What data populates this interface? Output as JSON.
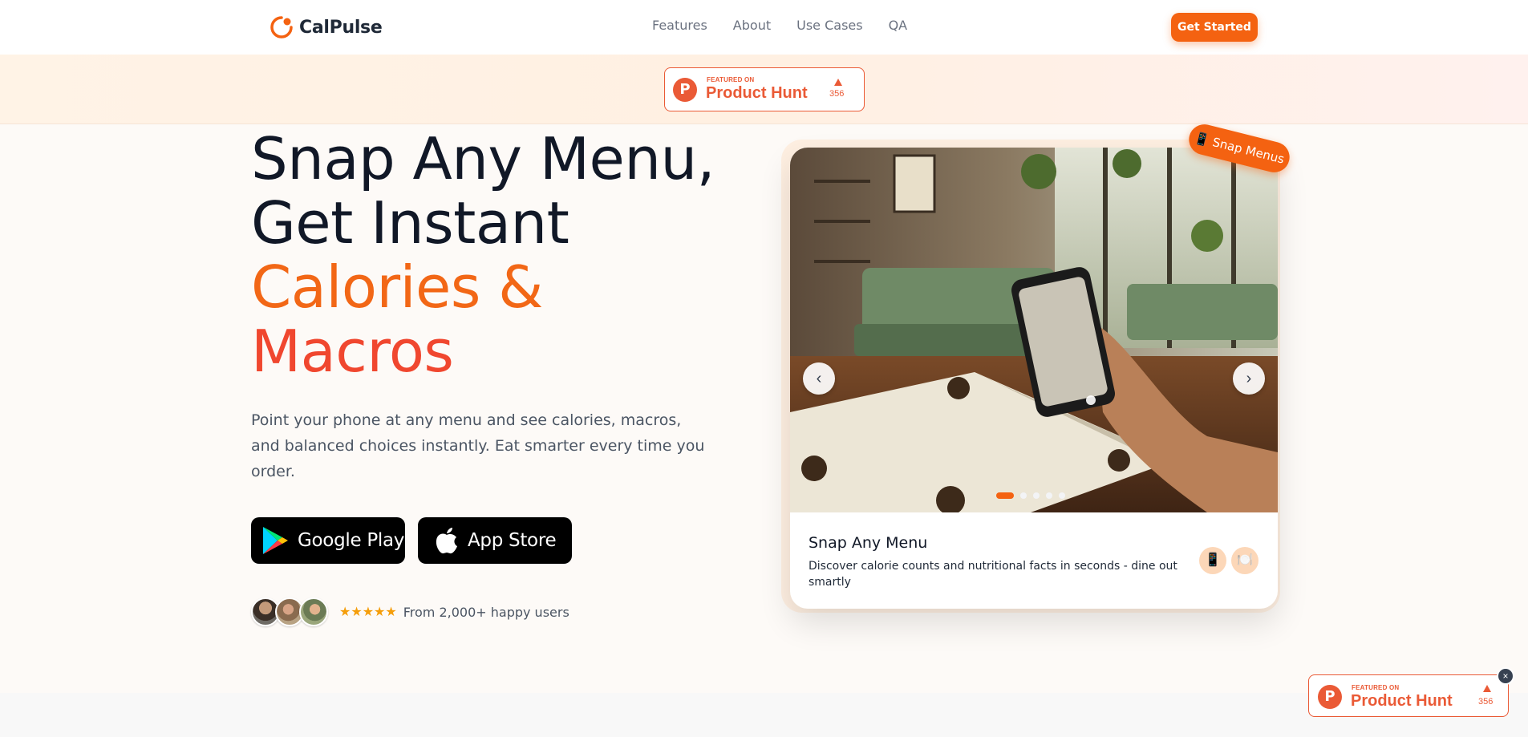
{
  "nav": {
    "brand": "CalPulse",
    "links": [
      "Features",
      "About",
      "Use Cases",
      "QA"
    ],
    "cta_label": "Get Started"
  },
  "product_hunt": {
    "featured_label": "FEATURED ON",
    "name": "Product Hunt",
    "upvotes": "356"
  },
  "hero": {
    "title_line1": "Snap Any Menu,",
    "title_line2": "Get Instant",
    "title_line3": "Calories &",
    "title_line4": "Macros",
    "description": "Point your phone at any menu and see calories, macros, and balanced choices instantly. Eat smarter every time you order.",
    "google_play_label": "Google Play",
    "app_store_label": "App Store",
    "rating_stars": "★★★★★",
    "social_proof": "From 2,000+ happy users"
  },
  "carousel": {
    "badge": "📱 Snap Menus",
    "slide_title": "Snap Any Menu",
    "slide_description": "Discover calorie counts and nutritional facts in seconds - dine out smartly",
    "prev_label": "‹",
    "next_label": "›",
    "dot_count": 5,
    "active_dot": 0,
    "icons": [
      "📱",
      "🍽️"
    ]
  },
  "close_label": "×",
  "colors": {
    "accent": "#f46211",
    "accent_red": "#f0472f",
    "product_hunt": "#ea5a36"
  }
}
